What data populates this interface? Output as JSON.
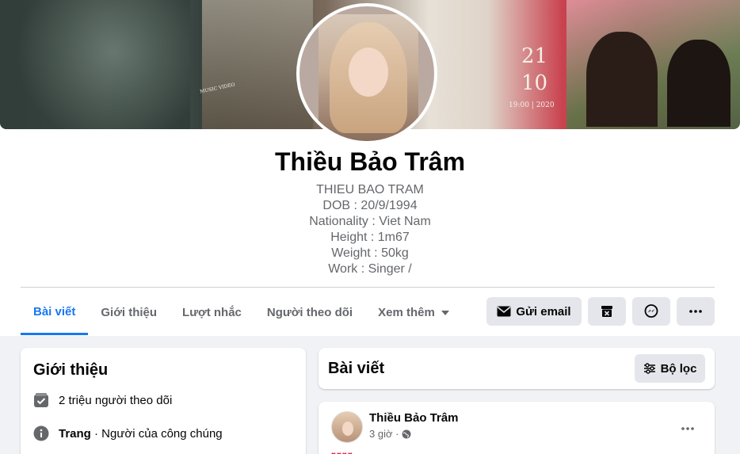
{
  "profile": {
    "name": "Thiều Bảo Trâm",
    "bio_lines": [
      "THIEU BAO TRAM",
      "DOB : 20/9/1994",
      "Nationality : Viet Nam",
      "Height : 1m67",
      "Weight : 50kg",
      "Work : Singer /"
    ]
  },
  "cover": {
    "date_day": "21",
    "date_month": "10",
    "time_text": "19:00 | 2020",
    "mv_text": "MUSIC VIDEO"
  },
  "tabs": [
    {
      "label": "Bài viết",
      "active": true
    },
    {
      "label": "Giới thiệu",
      "active": false
    },
    {
      "label": "Lượt nhắc",
      "active": false
    },
    {
      "label": "Người theo dõi",
      "active": false
    },
    {
      "label": "Xem thêm",
      "active": false
    }
  ],
  "actions": {
    "email_label": "Gửi email",
    "archive_icon": "archive-x-icon",
    "messenger_icon": "messenger-icon",
    "more_icon": "more-icon"
  },
  "intro": {
    "title": "Giới thiệu",
    "followers": "2 triệu người theo dõi",
    "page_type_prefix": "Trang",
    "page_type_suffix": " · Người của công chúng"
  },
  "posts": {
    "title": "Bài viết",
    "filter_label": "Bộ lọc",
    "first_post": {
      "author": "Thiều Bảo Trâm",
      "time": "3 giờ ·"
    }
  },
  "colors": {
    "accent": "#1877f2",
    "button_bg": "#e4e6eb",
    "muted_text": "#65676b",
    "page_bg": "#f0f2f5"
  }
}
